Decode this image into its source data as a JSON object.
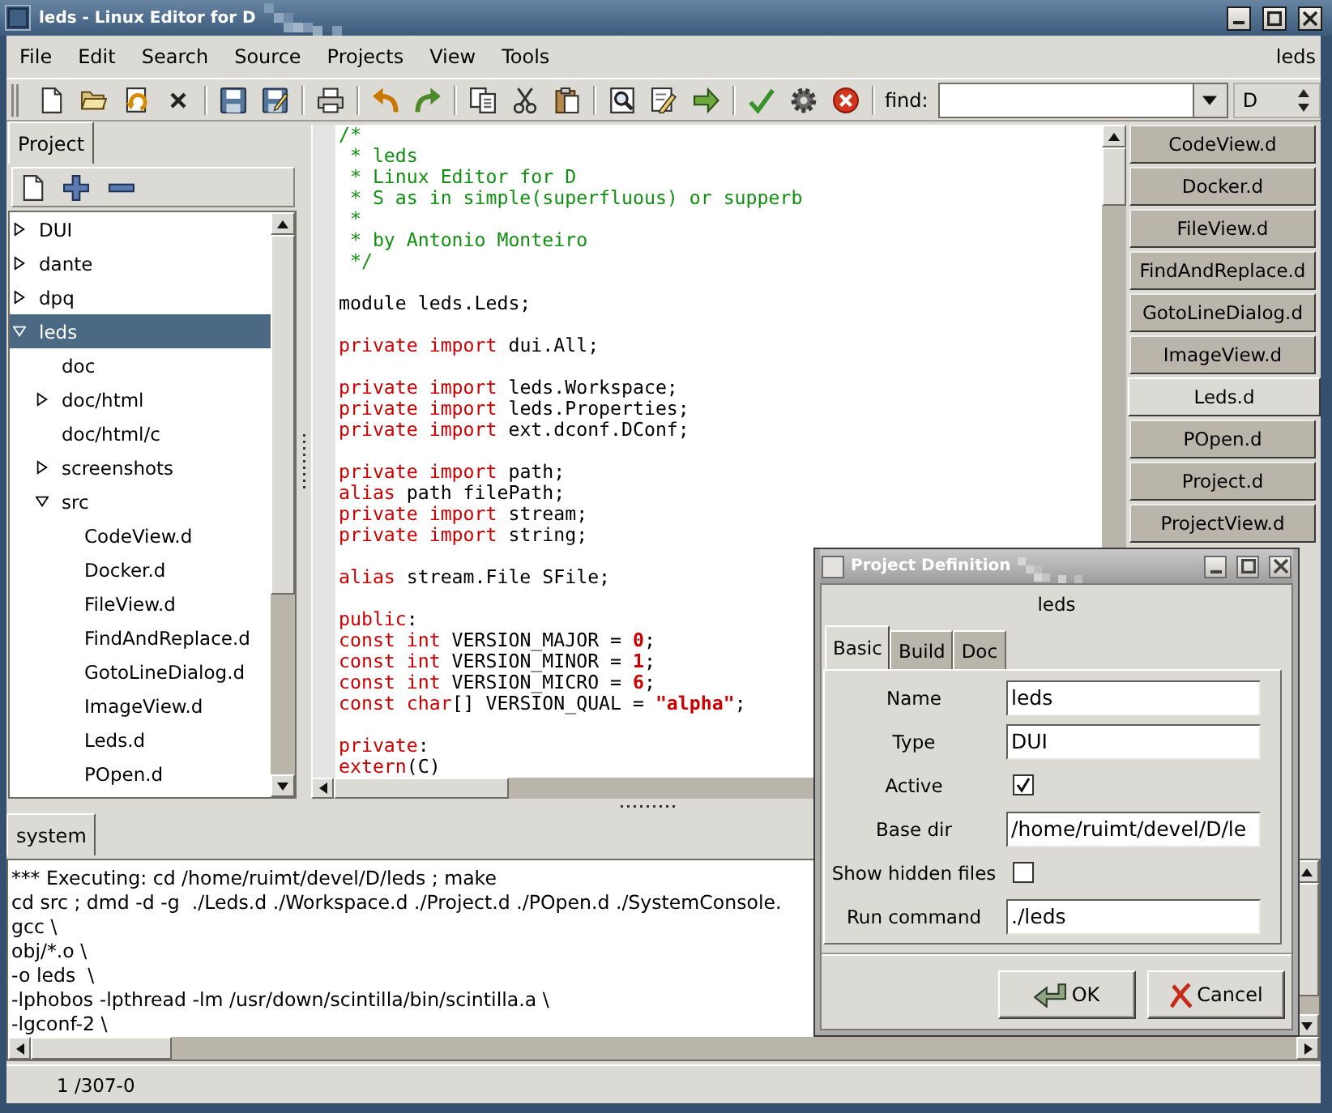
{
  "window": {
    "title": "leds - Linux Editor for D"
  },
  "menu": {
    "items": [
      {
        "label": "File"
      },
      {
        "label": "Edit"
      },
      {
        "label": "Search"
      },
      {
        "label": "Source"
      },
      {
        "label": "Projects"
      },
      {
        "label": "View"
      },
      {
        "label": "Tools"
      }
    ],
    "project_label": "leds"
  },
  "toolbar": {
    "find_label": "find:",
    "language": "D"
  },
  "project_panel": {
    "tabs": [
      {
        "label": "Project",
        "selected": true
      }
    ],
    "tree": [
      {
        "label": "DUI",
        "kind": "node",
        "expanded": false,
        "selected": false
      },
      {
        "label": "dante",
        "kind": "node",
        "expanded": false,
        "selected": false
      },
      {
        "label": "dpq",
        "kind": "node",
        "expanded": false,
        "selected": false
      },
      {
        "label": "leds",
        "kind": "node",
        "expanded": true,
        "selected": true,
        "children": [
          {
            "label": "doc",
            "kind": "leaf",
            "selected": false
          },
          {
            "label": "doc/html",
            "kind": "node",
            "expanded": false,
            "selected": false
          },
          {
            "label": "doc/html/c",
            "kind": "leaf",
            "selected": false
          },
          {
            "label": "screenshots",
            "kind": "node",
            "expanded": false,
            "selected": false
          },
          {
            "label": "src",
            "kind": "node",
            "expanded": true,
            "selected": false,
            "children": [
              {
                "label": "CodeView.d",
                "kind": "leaf",
                "selected": false
              },
              {
                "label": "Docker.d",
                "kind": "leaf",
                "selected": false
              },
              {
                "label": "FileView.d",
                "kind": "leaf",
                "selected": false
              },
              {
                "label": "FindAndReplace.d",
                "kind": "leaf",
                "selected": false
              },
              {
                "label": "GotoLineDialog.d",
                "kind": "leaf",
                "selected": false
              },
              {
                "label": "ImageView.d",
                "kind": "leaf",
                "selected": false
              },
              {
                "label": "Leds.d",
                "kind": "leaf",
                "selected": false
              },
              {
                "label": "POpen.d",
                "kind": "leaf",
                "selected": false
              }
            ]
          }
        ]
      }
    ]
  },
  "editor": {
    "blocks": [
      [
        [
          {
            "kind": "comment",
            "text": "/*"
          }
        ],
        [
          {
            "kind": "comment",
            "text": " * leds"
          }
        ],
        [
          {
            "kind": "comment",
            "text": " * Linux Editor for D"
          }
        ],
        [
          {
            "kind": "comment",
            "text": " * S as in simple(superfluous) or supperb"
          }
        ],
        [
          {
            "kind": "comment",
            "text": " *"
          }
        ],
        [
          {
            "kind": "comment",
            "text": " * by Antonio Monteiro"
          }
        ],
        [
          {
            "kind": "comment",
            "text": " */"
          }
        ]
      ],
      [
        [
          {
            "kind": "plain",
            "text": "module leds.Leds;"
          }
        ]
      ],
      [
        [
          {
            "kind": "keyword",
            "text": "private import"
          },
          {
            "kind": "plain",
            "text": " dui.All;"
          }
        ]
      ],
      [
        [
          {
            "kind": "keyword",
            "text": "private import"
          },
          {
            "kind": "plain",
            "text": " leds.Workspace;"
          }
        ],
        [
          {
            "kind": "keyword",
            "text": "private import"
          },
          {
            "kind": "plain",
            "text": " leds.Properties;"
          }
        ],
        [
          {
            "kind": "keyword",
            "text": "private import"
          },
          {
            "kind": "plain",
            "text": " ext.dconf.DConf;"
          }
        ]
      ],
      [
        [
          {
            "kind": "keyword",
            "text": "private import"
          },
          {
            "kind": "plain",
            "text": " path;"
          }
        ],
        [
          {
            "kind": "keyword",
            "text": "alias"
          },
          {
            "kind": "plain",
            "text": " path filePath;"
          }
        ],
        [
          {
            "kind": "keyword",
            "text": "private import"
          },
          {
            "kind": "plain",
            "text": " stream;"
          }
        ],
        [
          {
            "kind": "keyword",
            "text": "private import"
          },
          {
            "kind": "plain",
            "text": " string;"
          }
        ]
      ],
      [
        [
          {
            "kind": "keyword",
            "text": "alias"
          },
          {
            "kind": "plain",
            "text": " stream.File SFile;"
          }
        ]
      ],
      [
        [
          {
            "kind": "keyword",
            "text": "public"
          },
          {
            "kind": "plain",
            "text": ":"
          }
        ],
        [
          {
            "kind": "keyword",
            "text": "const int"
          },
          {
            "kind": "plain",
            "text": " VERSION_MAJOR = "
          },
          {
            "kind": "number",
            "text": "0"
          },
          {
            "kind": "plain",
            "text": ";"
          }
        ],
        [
          {
            "kind": "keyword",
            "text": "const int"
          },
          {
            "kind": "plain",
            "text": " VERSION_MINOR = "
          },
          {
            "kind": "number",
            "text": "1"
          },
          {
            "kind": "plain",
            "text": ";"
          }
        ],
        [
          {
            "kind": "keyword",
            "text": "const int"
          },
          {
            "kind": "plain",
            "text": " VERSION_MICRO = "
          },
          {
            "kind": "number",
            "text": "6"
          },
          {
            "kind": "plain",
            "text": ";"
          }
        ],
        [
          {
            "kind": "keyword",
            "text": "const char"
          },
          {
            "kind": "plain",
            "text": "[] VERSION_QUAL = "
          },
          {
            "kind": "string",
            "text": "\"alpha\""
          },
          {
            "kind": "plain",
            "text": ";"
          }
        ]
      ],
      [
        [
          {
            "kind": "keyword",
            "text": "private"
          },
          {
            "kind": "plain",
            "text": ":"
          }
        ],
        [
          {
            "kind": "keyword",
            "text": "extern"
          },
          {
            "kind": "plain",
            "text": "(C)"
          }
        ]
      ]
    ]
  },
  "file_tabs": [
    {
      "label": "CodeView.d",
      "selected": false
    },
    {
      "label": "Docker.d",
      "selected": false
    },
    {
      "label": "FileView.d",
      "selected": false
    },
    {
      "label": "FindAndReplace.d",
      "selected": false
    },
    {
      "label": "GotoLineDialog.d",
      "selected": false
    },
    {
      "label": "ImageView.d",
      "selected": false
    },
    {
      "label": "Leds.d",
      "selected": true
    },
    {
      "label": "POpen.d",
      "selected": false
    },
    {
      "label": "Project.d",
      "selected": false
    },
    {
      "label": "ProjectView.d",
      "selected": false
    }
  ],
  "console": {
    "tabs": [
      {
        "label": "system",
        "selected": true
      }
    ],
    "lines": [
      "*** Executing: cd /home/ruimt/devel/D/leds ; make",
      "cd src ; dmd -d -g  ./Leds.d ./Workspace.d ./Project.d ./POpen.d ./SystemConsole.",
      "gcc \\",
      "obj/*.o \\",
      "-o leds  \\",
      "-lphobos -lpthread -lm /usr/down/scintilla/bin/scintilla.a \\",
      "-lgconf-2 \\"
    ]
  },
  "status_bar": {
    "position": "1 /307-0"
  },
  "dialog": {
    "title": "Project Definition",
    "project": "leds",
    "tabs": [
      {
        "label": "Basic",
        "selected": true
      },
      {
        "label": "Build",
        "selected": false
      },
      {
        "label": "Doc",
        "selected": false
      }
    ],
    "fields": [
      {
        "label": "Name",
        "kind": "text",
        "value": "leds"
      },
      {
        "label": "Type",
        "kind": "text",
        "value": "DUI"
      },
      {
        "label": "Active",
        "kind": "checkbox",
        "checked": true
      },
      {
        "label": "Base dir",
        "kind": "text",
        "value": "/home/ruimt/devel/D/le"
      },
      {
        "label": "Show hidden files",
        "kind": "checkbox",
        "checked": false
      },
      {
        "label": "Run command",
        "kind": "text",
        "value": "./leds"
      }
    ],
    "buttons": [
      {
        "label": "OK",
        "kind": "ok"
      },
      {
        "label": "Cancel",
        "kind": "cancel"
      }
    ]
  }
}
